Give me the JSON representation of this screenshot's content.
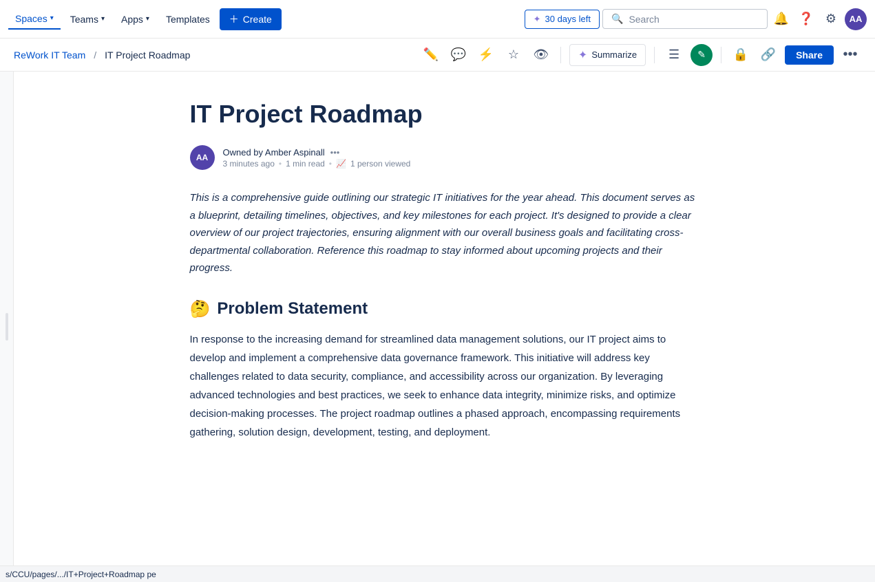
{
  "topnav": {
    "spaces_label": "Spaces",
    "teams_label": "Teams",
    "apps_label": "Apps",
    "templates_label": "Templates",
    "create_label": "+ Create",
    "trial_label": "30 days left",
    "search_placeholder": "Search",
    "avatar_initials": "AA"
  },
  "toolbar": {
    "breadcrumb_team": "ReWork IT Team",
    "breadcrumb_sep": "/",
    "breadcrumb_page": "IT Project Roadmap",
    "summarize_label": "Summarize",
    "share_label": "Share"
  },
  "document": {
    "title": "IT Project Roadmap",
    "author_initials": "AA",
    "owner_text": "Owned by Amber Aspinall",
    "time_ago": "3 minutes ago",
    "read_time": "1 min read",
    "views": "1 person viewed",
    "intro": "This is a comprehensive guide outlining our strategic IT initiatives for the year ahead. This document serves as a blueprint, detailing timelines, objectives, and key milestones for each project. It's designed to provide a clear overview of our project trajectories, ensuring alignment with our overall business goals and facilitating cross-departmental collaboration. Reference this roadmap to stay informed about upcoming projects and their progress.",
    "section1_emoji": "🤔",
    "section1_title": "Problem Statement",
    "section1_body": "In response to the increasing demand for streamlined data management solutions, our IT project aims to develop and implement a comprehensive data governance framework. This initiative will address key challenges related to data security, compliance, and accessibility across our organization. By leveraging advanced technologies and best practices, we seek to enhance data integrity, minimize risks, and optimize decision-making processes. The project roadmap outlines a phased approach, encompassing requirements gathering, solution design, development, testing, and deployment."
  },
  "statusbar": {
    "url": "s/CCU/pages/.../IT+Project+Roadmap",
    "suffix": "pe"
  }
}
